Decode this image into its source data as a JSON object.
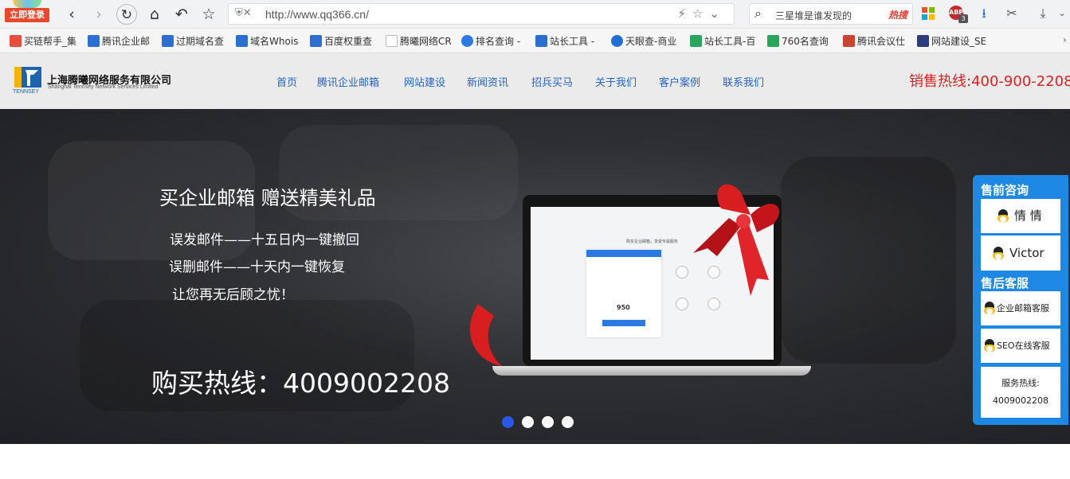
{
  "browser": {
    "login_label": "立即登录",
    "url": "http://www.qq366.cn/",
    "search_query": "三星堆是谁发现的",
    "hot_label": "热搜",
    "abp_badge": "3"
  },
  "bookmarks": [
    {
      "label": "买链帮手_集",
      "color": "#e94e3c"
    },
    {
      "label": "腾讯企业邮",
      "color": "#2a6fd1"
    },
    {
      "label": "过期域名查",
      "color": "#2a6fd1"
    },
    {
      "label": "域名Whois",
      "color": "#2a6fd1"
    },
    {
      "label": "百度权重查",
      "color": "#2a6fd1"
    },
    {
      "label": "腾曦网络CR",
      "color": "#bbbbbb"
    },
    {
      "label": "排名查询 -",
      "color": "#2a7ae2"
    },
    {
      "label": "站长工具 -",
      "color": "#2a6fd1"
    },
    {
      "label": "天眼查-商业",
      "color": "#1f6fd6"
    },
    {
      "label": "站长工具-百",
      "color": "#2aa65c"
    },
    {
      "label": "760名查询",
      "color": "#2aa65c"
    },
    {
      "label": "腾讯会议仕",
      "color": "#c9452e"
    },
    {
      "label": "网站建设_SE",
      "color": "#2c3e7a"
    }
  ],
  "site": {
    "logo_cn": "上海腾曦网络服务有限公司",
    "logo_en": "Shanghai Tennsey Network Services Limited",
    "logo_sub": "TENNSEY",
    "menu": [
      "首页",
      "腾讯企业邮箱",
      "网站建设",
      "新闻资讯",
      "招兵买马",
      "关于我们",
      "客户案例",
      "联系我们"
    ],
    "hotline": "销售热线:400-900-2208"
  },
  "banner": {
    "title": "买企业邮箱  赠送精美礼品",
    "lines": [
      "误发邮件——十五日内一键撤回",
      "误删邮件——十天内一键恢复",
      "让您再无后顾之忧！"
    ],
    "buy_line": "购买热线：4009002208",
    "screen_head": "购买企业邮箱，享受专属服务",
    "screen_price": "950",
    "slides": 4,
    "active_slide": 0
  },
  "side": {
    "pre_title": "售前咨询",
    "pre_items": [
      "情 情",
      "Victor"
    ],
    "post_title": "售后客服",
    "post_items": [
      "企业邮箱客服",
      "SEO在线客服"
    ],
    "foot_label": "服务热线:",
    "foot_phone": "4009002208"
  },
  "colors": {
    "accent": "#1e88e5",
    "menu": "#2563c7",
    "hotline": "#e02020",
    "active_dot": "#2a58e6"
  }
}
